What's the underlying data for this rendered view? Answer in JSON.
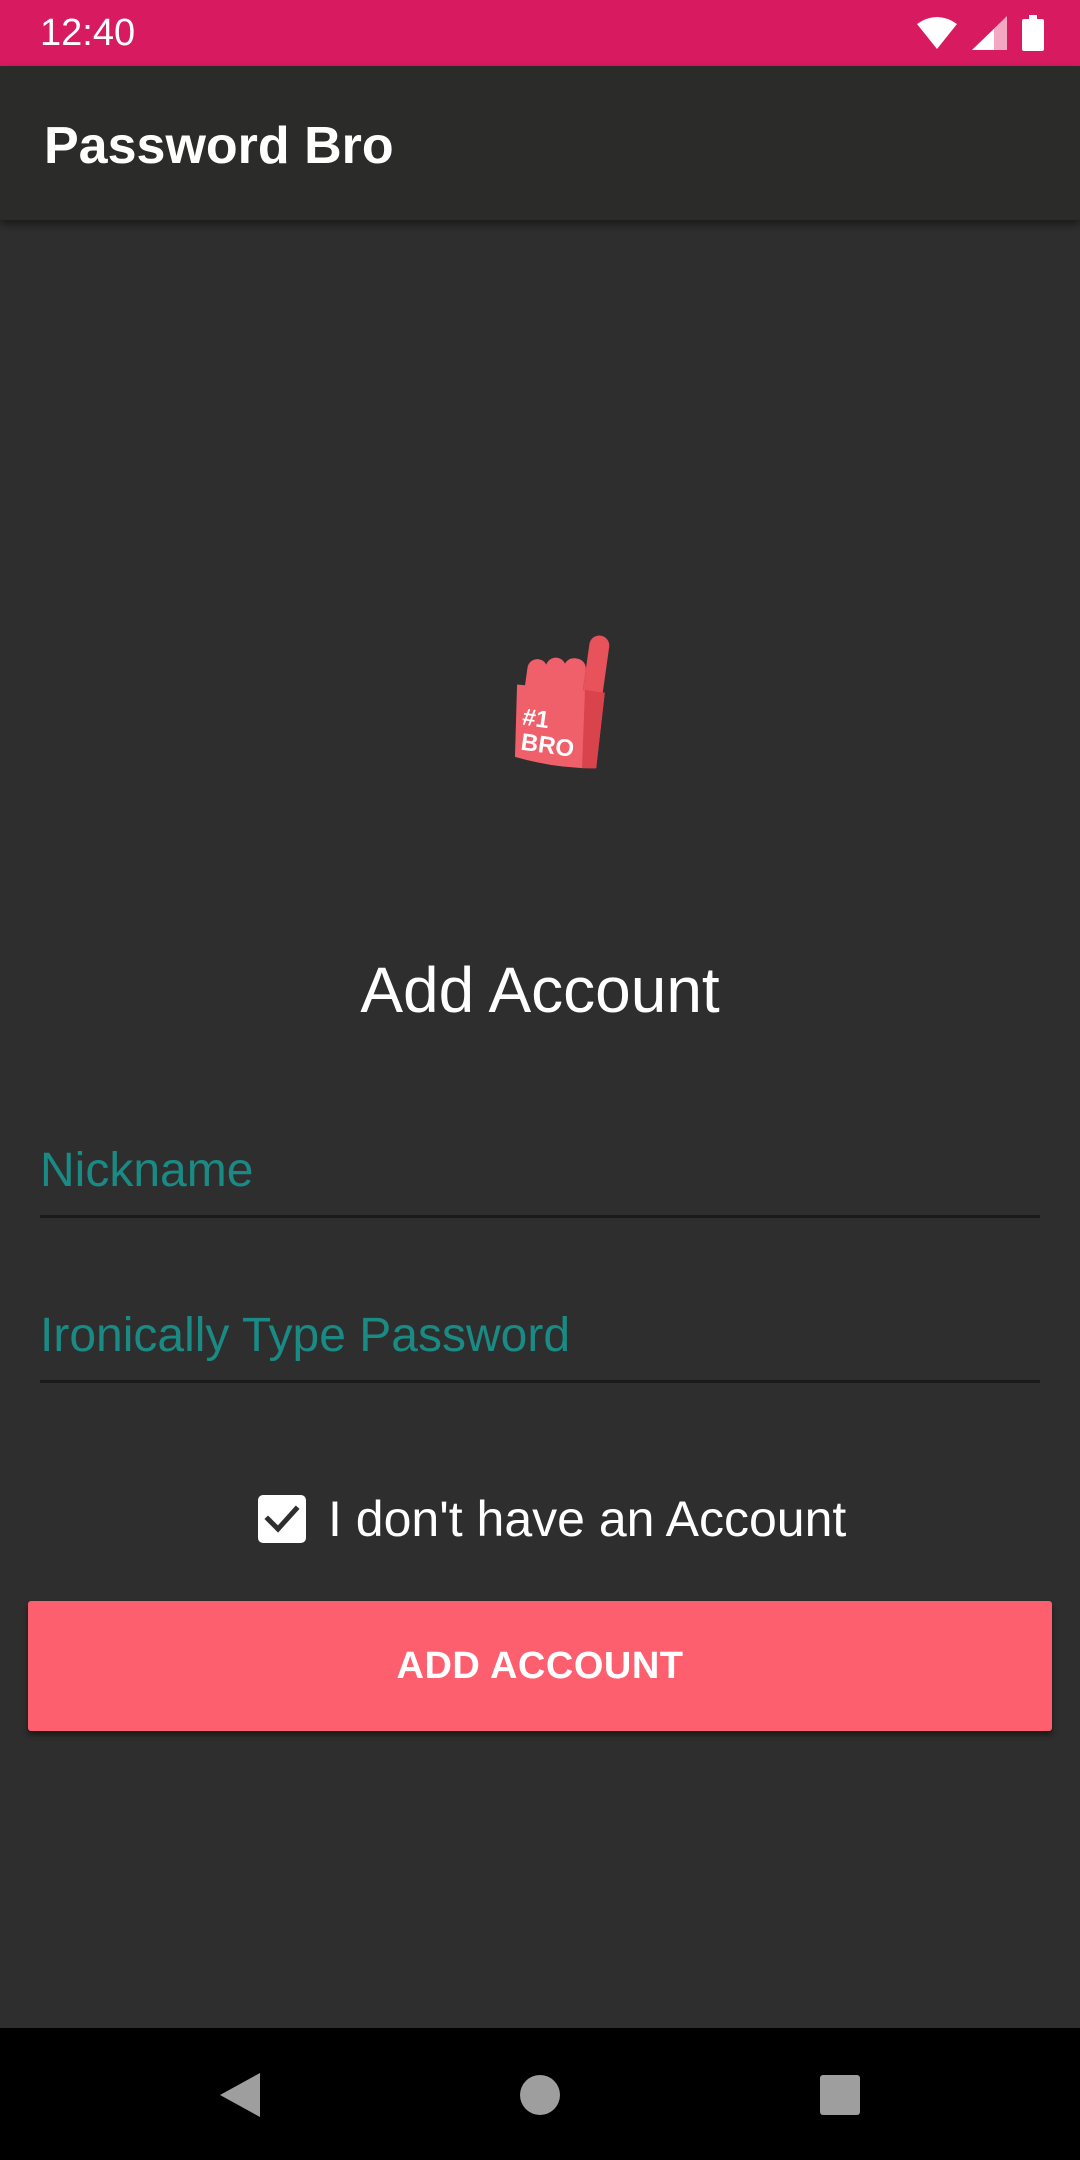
{
  "status_bar": {
    "time": "12:40",
    "icons": [
      "wifi-icon",
      "signal-icon",
      "battery-icon"
    ],
    "color": "#d81b60"
  },
  "app_bar": {
    "title": "Password Bro"
  },
  "logo": {
    "icon": "foam-finger-icon",
    "line1": "#1",
    "line2": "BRO"
  },
  "form": {
    "heading": "Add Account",
    "nickname_placeholder": "Ironically Type Password",
    "nickname_field_placeholder": "Nickname",
    "checkbox_label": "I don't have an Account",
    "checkbox_checked": true,
    "submit_label": "ADD ACCOUNT"
  },
  "colors": {
    "accent": "#fe5f6f",
    "hint": "#1a8a84",
    "background": "#2e2e2e"
  },
  "nav_bar": {
    "icons": [
      "back-icon",
      "home-icon",
      "recents-icon"
    ]
  }
}
